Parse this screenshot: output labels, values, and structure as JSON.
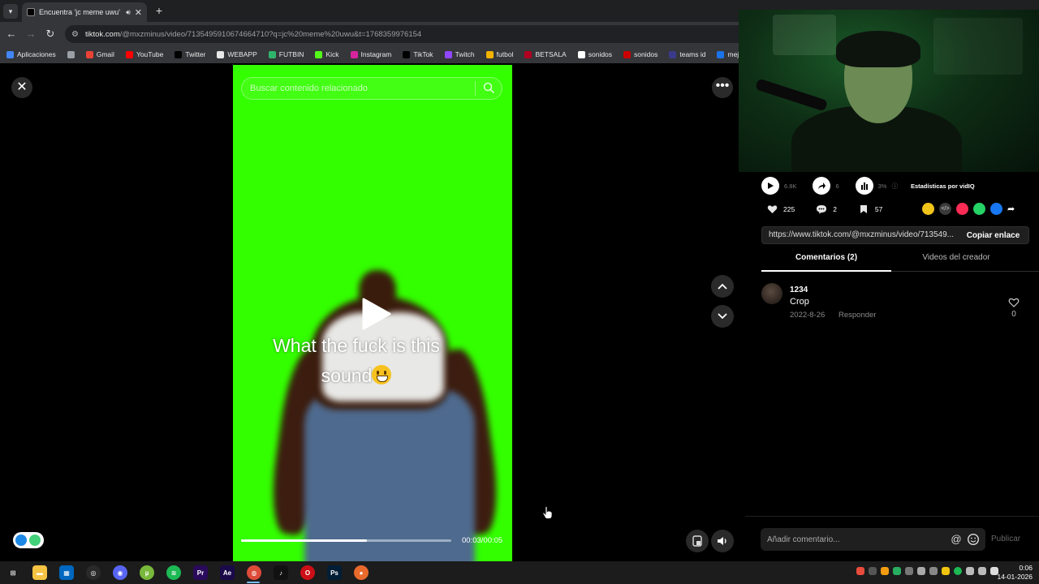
{
  "browser": {
    "tab_title": "Encuentra 'jc meme uwu' en",
    "new_tab_symbol": "+",
    "url_host": "tiktok.com",
    "url_path": "/@mxzminus/video/7135495910674664710?q=jc%20meme%20uwu&t=1768359976154",
    "bookmarks": [
      {
        "label": "Aplicaciones",
        "color": "#4285f4"
      },
      {
        "label": "",
        "color": "#9aa0a6"
      },
      {
        "label": "Gmail",
        "color": "#ea4335"
      },
      {
        "label": "YouTube",
        "color": "#ff0000"
      },
      {
        "label": "Twitter",
        "color": "#000000"
      },
      {
        "label": "WEBAPP",
        "color": "#e8e8e8"
      },
      {
        "label": "FUTBIN",
        "color": "#2fb56b"
      },
      {
        "label": "Kick",
        "color": "#53fc18"
      },
      {
        "label": "Instagram",
        "color": "#d6249f"
      },
      {
        "label": "TikTok",
        "color": "#000000"
      },
      {
        "label": "Twitch",
        "color": "#9146ff"
      },
      {
        "label": "futbol",
        "color": "#f4b400"
      },
      {
        "label": "BETSALA",
        "color": "#b00020"
      },
      {
        "label": "sonidos",
        "color": "#ffffff"
      },
      {
        "label": "sonidos",
        "color": "#cc0000"
      },
      {
        "label": "teams id",
        "color": "#3a3a8a"
      },
      {
        "label": "mejora foto",
        "color": "#1a73e8"
      }
    ]
  },
  "video": {
    "search_placeholder": "Buscar contenido relacionado",
    "caption_line1": "What the fuck is this",
    "caption_line2": "sound",
    "progress": 0.6,
    "time_label": "00:03/00:05",
    "background_color": "#33ff00"
  },
  "side": {
    "plays": "6.8K",
    "shares": "6",
    "engagement": "3%",
    "stats_label": "Estadísticas por vidIQ",
    "likes": "225",
    "comments": "2",
    "saves": "57",
    "link_url": "https://www.tiktok.com/@mxzminus/video/713549...",
    "copy_link_label": "Copiar enlace",
    "tab_comments": "Comentarios (2)",
    "tab_videos": "Videos del creador",
    "comment": {
      "user": "1234",
      "text": "Crop",
      "date": "2022-8-26",
      "reply": "Responder",
      "likes": "0"
    },
    "composer_placeholder": "Añadir comentario...",
    "mention_symbol": "@",
    "publish_label": "Publicar"
  },
  "taskbar": {
    "apps": [
      "start",
      "explorer",
      "store",
      "steam",
      "discord",
      "utorrent",
      "spotify",
      "premiere",
      "after-effects",
      "chrome",
      "tiktok",
      "opera",
      "photoshop",
      "app"
    ],
    "time": "0:06",
    "date": "14-01-2026"
  }
}
